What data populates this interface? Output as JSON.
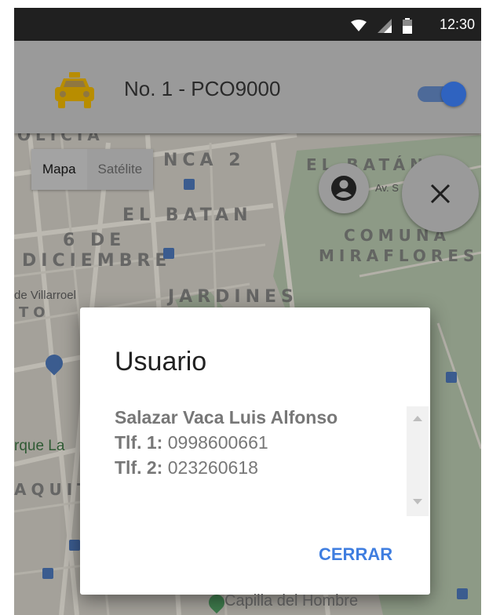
{
  "status_bar": {
    "time": "12:30",
    "icons": [
      "wifi-icon",
      "signal-icon",
      "battery-icon"
    ]
  },
  "app_bar": {
    "title": "No. 1 - PCO9000",
    "icon": "taxi-icon",
    "toggle_on": true
  },
  "map": {
    "type_control": {
      "active": "Mapa",
      "inactive": "Satélite"
    },
    "labels": {
      "top_left": "OLICIA",
      "nca": "NCA 2",
      "el_batan_top": "EL BATÁN",
      "el_batan": "EL BATAN",
      "six_de": "6 DE",
      "diciembre": "DICIEMBRE",
      "comuna": "COMUNA",
      "miraflores": "MIRAFLORES",
      "jardines": "JARDINES",
      "villarroel": "de Villarroel",
      "to": "TO",
      "rque_la": "rque La",
      "aquit": "AQUIT",
      "av": "Av. S",
      "capilla": "Capilla del Hombre"
    }
  },
  "buttons": {
    "user": "account-circle-icon",
    "close": "close-icon"
  },
  "dialog": {
    "title": "Usuario",
    "name": "Salazar Vaca Luis Alfonso",
    "phone1_label": "Tlf. 1:",
    "phone1": "0998600661",
    "phone2_label": "Tlf. 2:",
    "phone2": "023260618",
    "action": "CERRAR"
  },
  "colors": {
    "accent": "#3f7ee0",
    "taxi": "#e0b400",
    "status_bar": "#202020"
  }
}
